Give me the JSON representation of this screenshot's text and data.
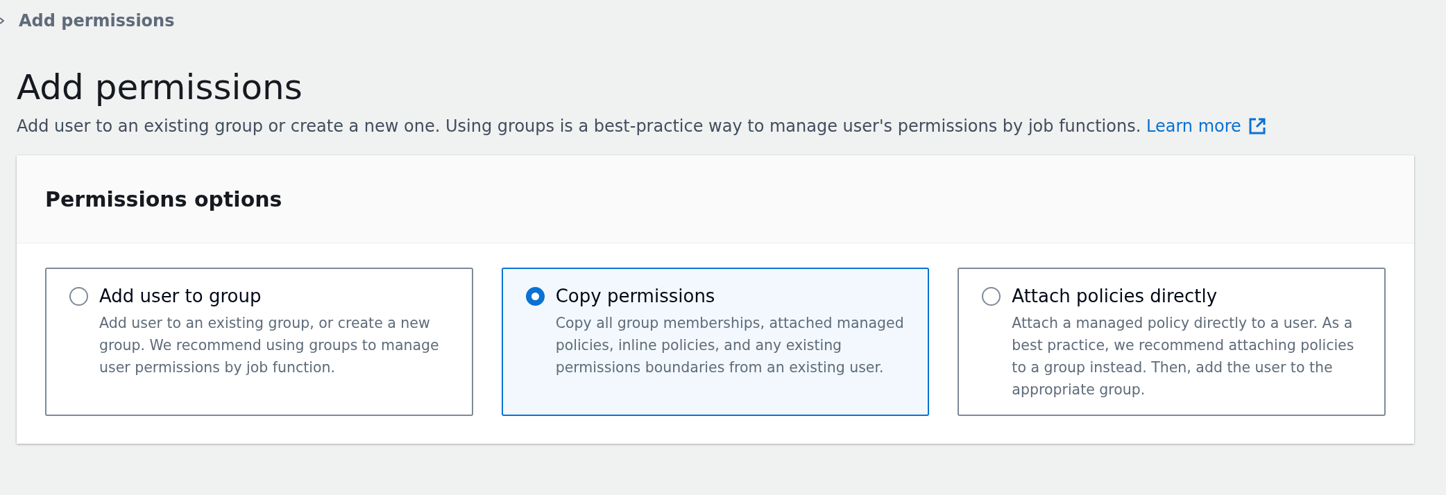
{
  "breadcrumb": {
    "label": "Add permissions"
  },
  "header": {
    "title": "Add permissions",
    "description": "Add user to an existing group or create a new one. Using groups is a best-practice way to manage user's permissions by job functions.",
    "link": "Learn more"
  },
  "panel": {
    "title": "Permissions options",
    "options": [
      {
        "label": "Add user to group",
        "description": "Add user to an existing group, or create a new group. We recommend using groups to manage user permissions by job function.",
        "selected": false
      },
      {
        "label": "Copy permissions",
        "description": "Copy all group memberships, attached managed policies, inline policies, and any existing permissions boundaries from an existing user.",
        "selected": true
      },
      {
        "label": "Attach policies directly",
        "description": "Attach a managed policy directly to a user. As a best practice, we recommend attaching policies to a group instead. Then, add the user to the appropriate group.",
        "selected": false
      }
    ]
  }
}
